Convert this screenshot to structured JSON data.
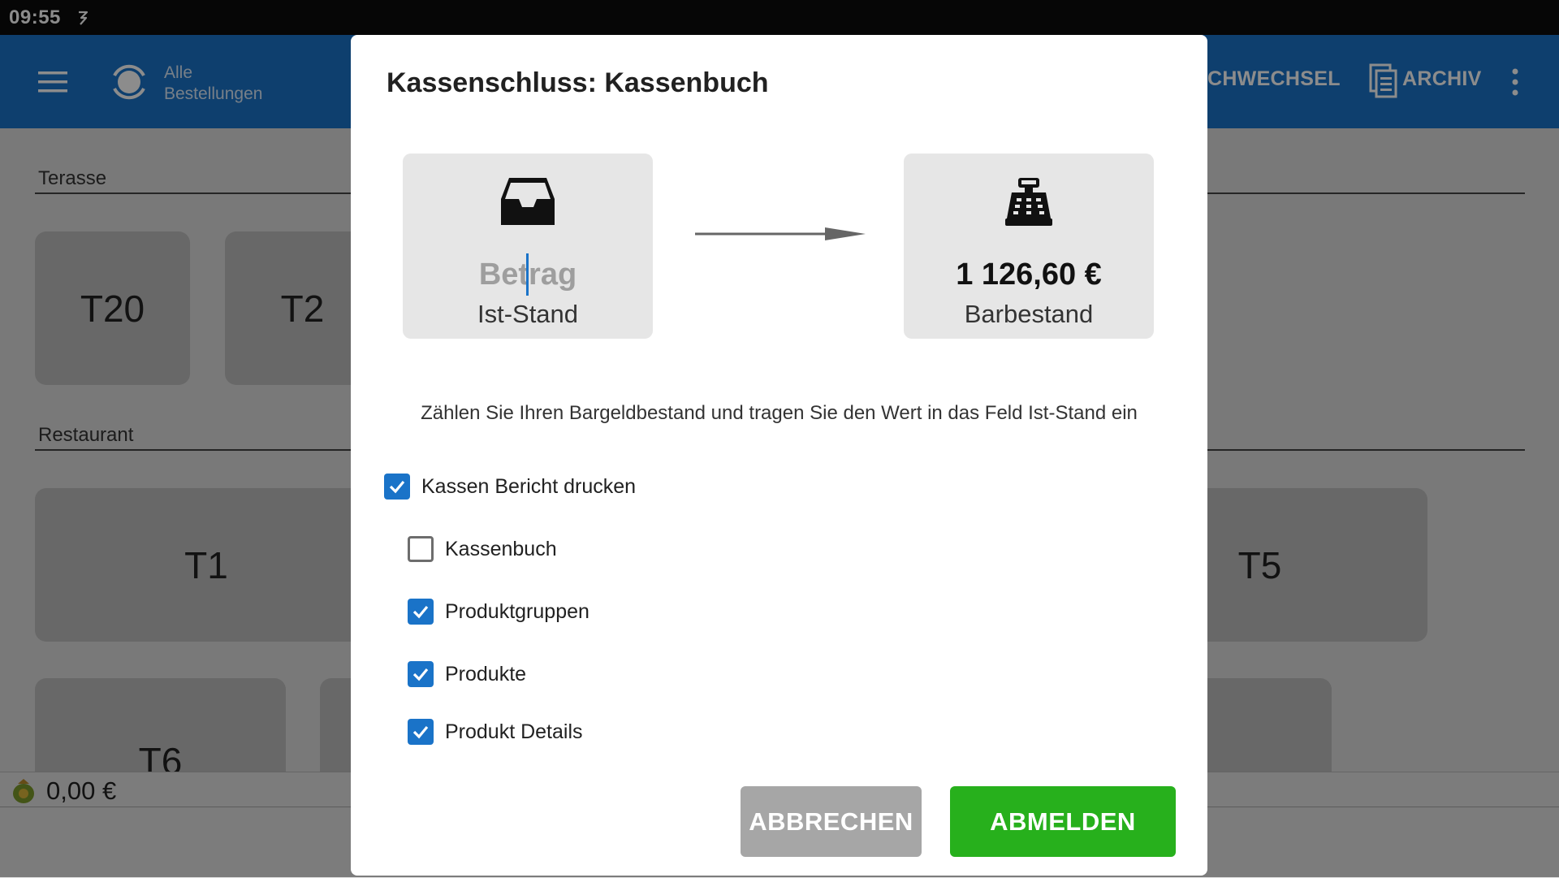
{
  "status_bar": {
    "time": "09:55"
  },
  "app_bar": {
    "orders_label_line1": "Alle",
    "orders_label_line2": "Bestellungen",
    "action_wechsel": "SCHWECHSEL",
    "action_archiv": "ARCHIV",
    "colors": {
      "bar": "#1a73c8"
    }
  },
  "floor": {
    "sections": [
      {
        "name": "Terasse",
        "tables": [
          "T20",
          "T2"
        ]
      },
      {
        "name": "Restaurant",
        "tables": [
          "T1",
          "T5",
          "T6"
        ]
      }
    ]
  },
  "footer": {
    "amount": "0,00 €"
  },
  "dialog": {
    "title": "Kassenschluss: Kassenbuch",
    "actual_card": {
      "placeholder": "Betrag",
      "caption": "Ist-Stand",
      "icon": "inbox-tray-icon"
    },
    "cash_card": {
      "value": "1 126,60 €",
      "caption": "Barbestand",
      "icon": "cash-register-icon"
    },
    "instruction": "Zählen Sie Ihren Bargeldbestand und tragen Sie den Wert in das Feld Ist-Stand ein",
    "options": {
      "print_report": {
        "label": "Kassen Bericht drucken",
        "checked": true
      },
      "kassenbuch": {
        "label": "Kassenbuch",
        "checked": false
      },
      "produktgruppen": {
        "label": "Produktgruppen",
        "checked": true
      },
      "produkte": {
        "label": "Produkte",
        "checked": true
      },
      "produkt_details": {
        "label": "Produkt Details",
        "checked": true
      }
    },
    "buttons": {
      "cancel": "ABBRECHEN",
      "logout": "ABMELDEN"
    },
    "colors": {
      "checkbox": "#1a73c8",
      "primary_button": "#27b01c",
      "secondary_button": "#a6a6a6"
    }
  }
}
